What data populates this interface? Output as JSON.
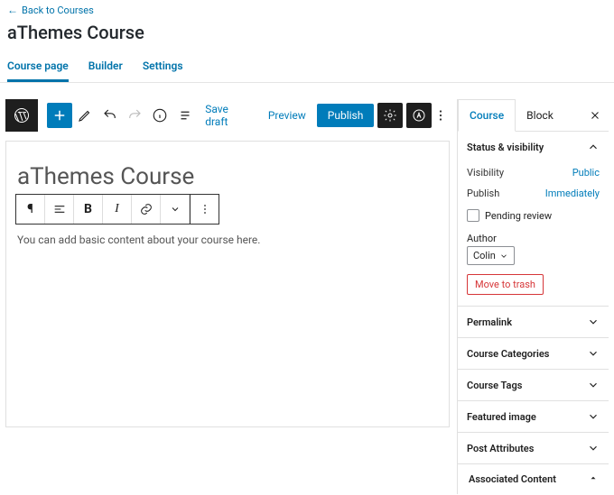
{
  "back_link": "Back to Courses",
  "page_title": "aThemes Course",
  "secondary_tabs": {
    "course_page": "Course page",
    "builder": "Builder",
    "settings": "Settings"
  },
  "topbar": {
    "save_draft": "Save draft",
    "preview": "Preview",
    "publish": "Publish"
  },
  "post": {
    "title": "aThemes Course",
    "body": "You can add basic content about your course here."
  },
  "block_toolbar": {
    "paragraph": "¶",
    "bold": "B",
    "italic": "I"
  },
  "sidebar": {
    "tabs": {
      "course": "Course",
      "block": "Block"
    },
    "status": {
      "heading": "Status & visibility",
      "visibility_label": "Visibility",
      "visibility_value": "Public",
      "publish_label": "Publish",
      "publish_value": "Immediately",
      "pending": "Pending review",
      "author_label": "Author",
      "author_value": "Colin",
      "trash": "Move to trash"
    },
    "panels": {
      "permalink": "Permalink",
      "categories": "Course Categories",
      "tags": "Course Tags",
      "featured": "Featured image",
      "attributes": "Post Attributes",
      "associated": "Associated Content"
    }
  }
}
